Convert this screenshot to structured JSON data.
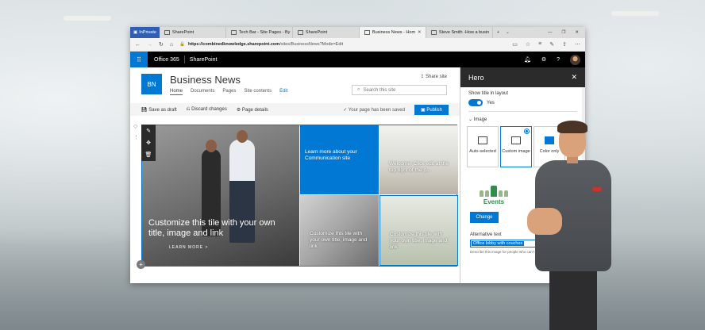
{
  "browser": {
    "inprivate_label": "InPrivate",
    "tabs": [
      {
        "label": "SharePoint",
        "active": false
      },
      {
        "label": "Tech Bar - Site Pages - By",
        "active": false
      },
      {
        "label": "SharePoint",
        "active": false
      },
      {
        "label": "Business News - Hom",
        "active": true
      },
      {
        "label": "Steve Smith -How a busin",
        "active": false
      }
    ],
    "new_tab": "+",
    "url_host": "https://combinedknowledge.sharepoint.com",
    "url_path": "/sites/BusinessNews?Mode=Edit"
  },
  "suitebar": {
    "app": "Office 365",
    "product": "SharePoint"
  },
  "site": {
    "logo_initials": "BN",
    "title": "Business News",
    "nav": [
      "Home",
      "Documents",
      "Pages",
      "Site contents",
      "Edit"
    ],
    "share": "Share site",
    "search_placeholder": "Search this site"
  },
  "commandbar": {
    "save_draft": "Save as draft",
    "discard": "Discard changes",
    "page_details": "Page details",
    "saved_status": "Your page has been saved",
    "publish": "Publish"
  },
  "hero_tiles": {
    "main_caption": "Customize this tile with your own title, image and link",
    "main_link": "LEARN MORE >",
    "blue_caption": "Learn more about your Communication site",
    "office_caption": "Welcome! Click edit at the top right of the p...",
    "arch_caption": "Customize this tile with your own title, image and link",
    "events_caption": "Customize this tile with your own title, image and link"
  },
  "panel": {
    "title": "Hero",
    "show_title_label": "Show title in layout",
    "show_title_value": "Yes",
    "image_section": "Image",
    "options": [
      "Auto-selected",
      "Custom image",
      "Color only"
    ],
    "selected_option": "Custom image",
    "events_label": "Events",
    "change_button": "Change",
    "alt_text_label": "Alternative text",
    "alt_text_value": "Office lobby with couches",
    "alt_text_hint": "Describe this image for people who can't see"
  },
  "colors": {
    "accent": "#0078d4",
    "suitebar": "#000000",
    "inprivate": "#2f5fb5"
  }
}
